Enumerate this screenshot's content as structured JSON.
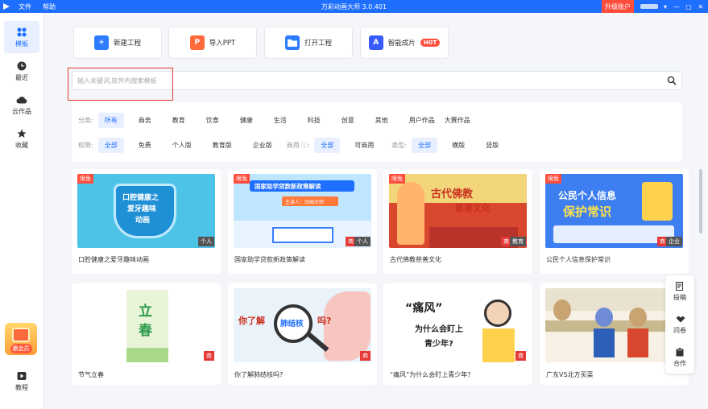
{
  "titlebar": {
    "menu": [
      "文件",
      "帮助"
    ],
    "app_title": "万彩动画大师 3.0.401",
    "upgrade_label": "升级账户"
  },
  "sidebar": {
    "items": [
      {
        "label": "模板",
        "icon": "grid-icon"
      },
      {
        "label": "最近",
        "icon": "clock-icon"
      },
      {
        "label": "云作品",
        "icon": "cloud-icon"
      },
      {
        "label": "收藏",
        "icon": "star-icon"
      }
    ],
    "promo_label": "赢会员",
    "tutorial_label": "教程"
  },
  "actions": [
    {
      "label": "新建工程",
      "icon": "new-project-icon",
      "color": "#2d7cff"
    },
    {
      "label": "导入PPT",
      "icon": "ppt-icon",
      "color": "#ff6a3d"
    },
    {
      "label": "打开工程",
      "icon": "folder-icon",
      "color": "#2d7cff"
    },
    {
      "label": "智能成片",
      "icon": "ai-logo-icon",
      "color": "#3a5bff",
      "badge": "HOT"
    }
  ],
  "search": {
    "placeholder": "输入关键词,软件内搜索模板"
  },
  "filters": {
    "category": {
      "label": "分类:",
      "options": [
        "所有",
        "商务",
        "教育",
        "饮食",
        "健康",
        "生活",
        "科技",
        "创意",
        "其他",
        "用户作品",
        "大赛作品"
      ],
      "selected": "所有"
    },
    "rights": {
      "label": "权限:",
      "options": [
        "全部",
        "免费",
        "个人版",
        "教育版",
        "企业版"
      ],
      "selected": "全部"
    },
    "commercial": {
      "label": "商用",
      "options": [
        "全部",
        "可商用"
      ],
      "selected": "全部"
    },
    "type": {
      "label": "类型:",
      "options": [
        "全部",
        "横版",
        "竖版"
      ],
      "selected": "全部"
    }
  },
  "templates": [
    {
      "title": "口腔健康之爱牙趣味动画",
      "badge": "限免",
      "tags": [
        "个人"
      ],
      "thumb_text": [
        "口腔健康之",
        "爱牙趣味",
        "动画"
      ]
    },
    {
      "title": "国家助学贷款新政策解读",
      "badge": "限免",
      "tags": [
        "商",
        "个人"
      ],
      "thumb_text": [
        "国家助学贷款新政策解读",
        "主讲人：动画大师"
      ]
    },
    {
      "title": "古代佛教慈善文化",
      "badge": "限免",
      "tags": [
        "商",
        "教育"
      ],
      "thumb_text": [
        "古代佛教",
        "慈善文化"
      ]
    },
    {
      "title": "公民个人信息保护常识",
      "badge": "限免",
      "tags": [
        "商",
        "企业"
      ],
      "thumb_text": [
        "公民个人信息",
        "保护常识"
      ]
    },
    {
      "title": "节气立春",
      "badge": "",
      "tags": [
        "商"
      ],
      "thumb_text": [
        "立",
        "春"
      ]
    },
    {
      "title": "你了解肺结核吗?",
      "badge": "",
      "tags": [
        "商"
      ],
      "thumb_text": [
        "你了解",
        "肺结核",
        "吗?"
      ]
    },
    {
      "title": "“痛风”为什么会盯上青少年?",
      "badge": "",
      "tags": [
        "商"
      ],
      "thumb_text": [
        "“痛风”",
        "为什么会盯上",
        "青少年?"
      ]
    },
    {
      "title": "广东VS北方买菜",
      "badge": "",
      "tags": [
        "商"
      ],
      "thumb_text": []
    }
  ],
  "float_panel": [
    {
      "label": "投稿",
      "icon": "edit-icon"
    },
    {
      "label": "问卷",
      "icon": "handshake-icon"
    },
    {
      "label": "合作",
      "icon": "clipboard-icon"
    }
  ]
}
